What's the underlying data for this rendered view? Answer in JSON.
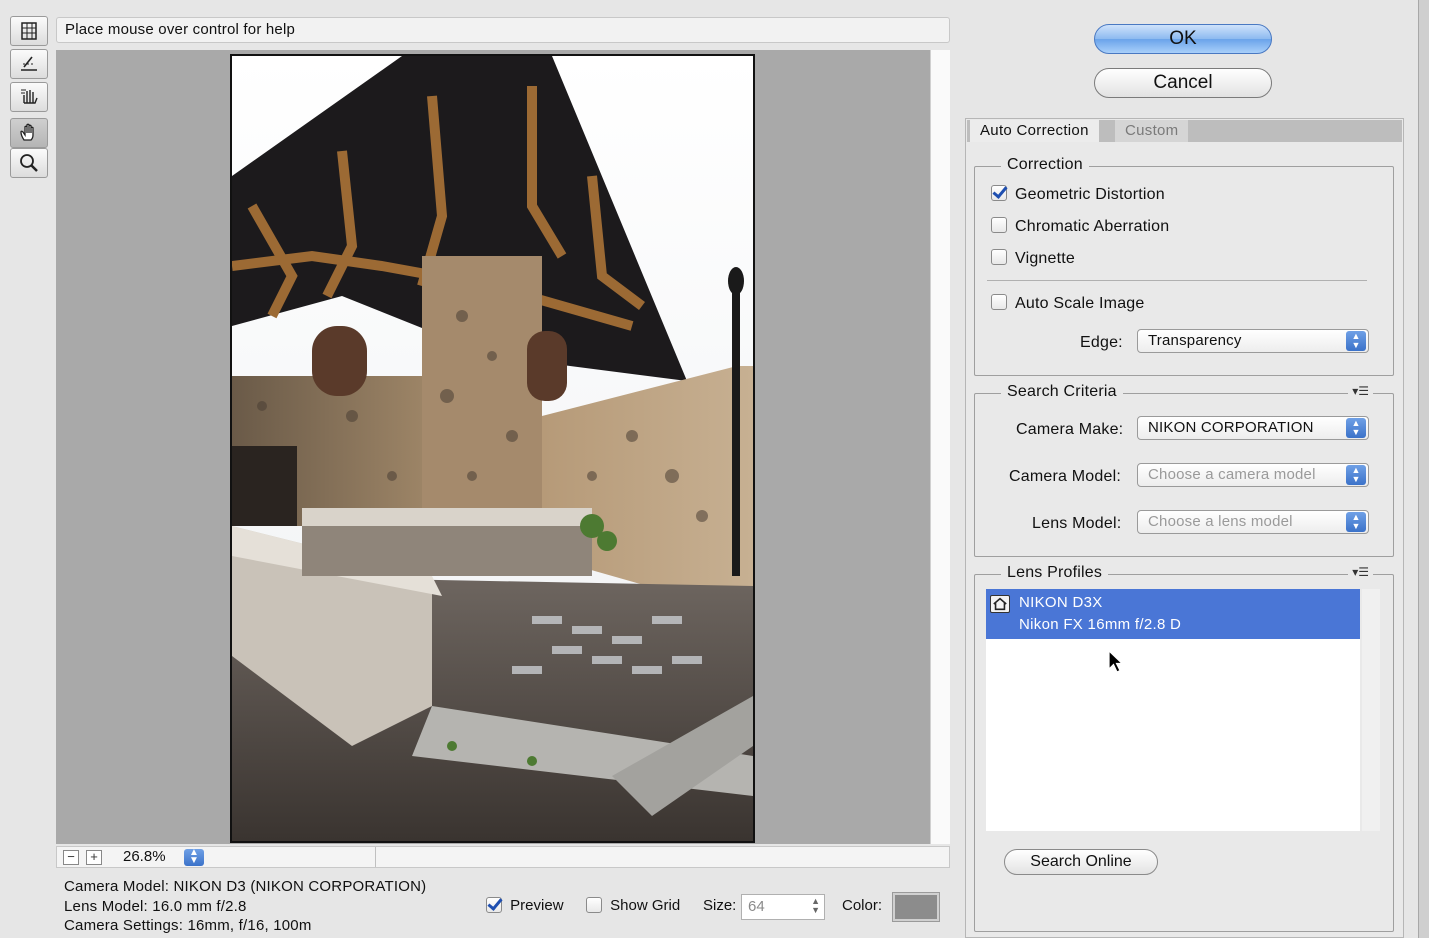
{
  "help_text": "Place mouse over control for help",
  "tools": [
    "remove-distortion-icon",
    "straighten-icon",
    "move-grid-icon",
    "hand-icon",
    "zoom-icon"
  ],
  "zoom": {
    "value": "26.8%",
    "minus": "−",
    "plus": "+"
  },
  "info": {
    "camera_model": "Camera Model: NIKON D3 (NIKON CORPORATION)",
    "lens_model": "Lens Model: 16.0 mm f/2.8",
    "camera_settings": "Camera Settings: 16mm, f/16, 100m"
  },
  "options": {
    "preview_label": "Preview",
    "preview_checked": true,
    "show_grid_label": "Show Grid",
    "show_grid_checked": false,
    "size_label": "Size:",
    "size_value": "64",
    "color_label": "Color:",
    "color_value": "#8c8c8c"
  },
  "buttons": {
    "ok": "OK",
    "cancel": "Cancel"
  },
  "tabs": [
    {
      "label": "Auto Correction",
      "active": true
    },
    {
      "label": "Custom",
      "active": false
    }
  ],
  "correction": {
    "title": "Correction",
    "geometric_distortion": "Geometric Distortion",
    "chromatic_aberration": "Chromatic Aberration",
    "vignette": "Vignette",
    "auto_scale": "Auto Scale Image",
    "edge_label": "Edge:",
    "edge_value": "Transparency"
  },
  "search": {
    "title": "Search Criteria",
    "camera_make_label": "Camera Make:",
    "camera_make_value": "NIKON CORPORATION",
    "camera_model_label": "Camera Model:",
    "camera_model_value": "Choose a camera model",
    "lens_model_label": "Lens Model:",
    "lens_model_value": "Choose a lens model"
  },
  "profiles": {
    "title": "Lens Profiles",
    "selected_camera": "NIKON D3X",
    "selected_lens": "Nikon FX 16mm f/2.8 D",
    "search_online": "Search Online"
  },
  "colors": {
    "selection": "#4a76d6",
    "accent": "#3b72c9"
  }
}
